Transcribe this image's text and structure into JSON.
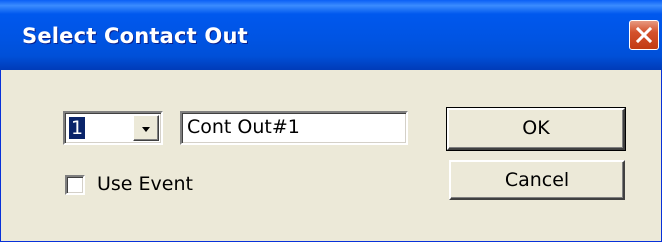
{
  "window": {
    "title": "Select Contact Out"
  },
  "titlebar": {
    "close_icon": "close-x-icon",
    "close_color": "#c23b13"
  },
  "contact_select": {
    "value": "1",
    "arrow_icon": "dropdown-arrow-icon"
  },
  "contact_name": {
    "value": "Cont Out#1"
  },
  "use_event": {
    "label": "Use Event",
    "checked": false
  },
  "buttons": {
    "ok_label": "OK",
    "cancel_label": "Cancel"
  },
  "colors": {
    "titlebar": "#0054e3",
    "dialog_bg": "#ece9d8",
    "selection": "#0a246a"
  }
}
